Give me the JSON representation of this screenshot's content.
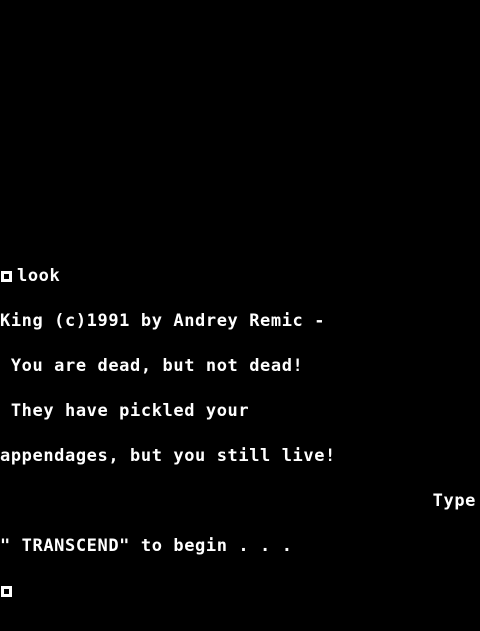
{
  "screen": {
    "background_color": "#000000",
    "text_color": "#ffffff"
  },
  "console": {
    "prompt_icon": "prompt-block-icon",
    "command": "look",
    "output_lines": [
      "King (c)1991 by Andrey Remic -",
      " You are dead, but not dead!",
      " They have pickled your",
      "appendages, but you still live!",
      "Type",
      "\" TRANSCEND\" to begin . . ."
    ],
    "cursor_icon": "input-cursor-block-icon"
  }
}
